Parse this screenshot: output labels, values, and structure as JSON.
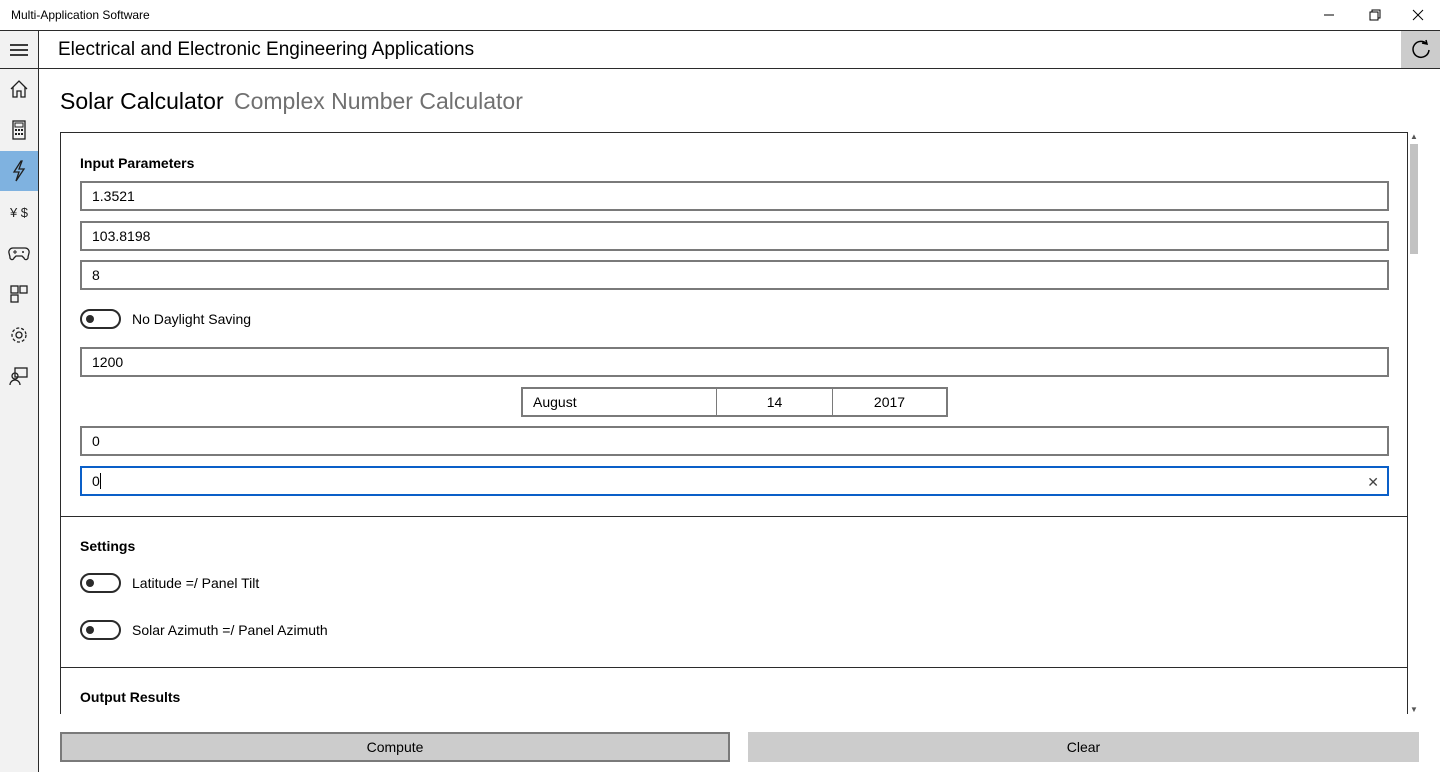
{
  "window": {
    "title": "Multi-Application Software",
    "controls": {
      "minimize_icon": "minimize-icon",
      "maximize_icon": "restore-icon",
      "close_icon": "close-icon"
    }
  },
  "header": {
    "title": "Electrical and Electronic Engineering Applications",
    "menu_icon": "hamburger-icon",
    "refresh_icon": "refresh-icon"
  },
  "sidebar": {
    "active_color": "#7fb2e0",
    "items": [
      {
        "icon": "home-icon",
        "label": ""
      },
      {
        "icon": "calculator-icon",
        "label": ""
      },
      {
        "icon": "lightning-icon",
        "label": "",
        "active": true
      },
      {
        "icon": "currency-icon",
        "label": "¥ $"
      },
      {
        "icon": "gamepad-icon",
        "label": ""
      },
      {
        "icon": "layout-icon",
        "label": ""
      },
      {
        "icon": "gear-icon",
        "label": ""
      },
      {
        "icon": "feedback-icon",
        "label": ""
      }
    ]
  },
  "tabs": [
    {
      "label": "Solar Calculator",
      "selected": true
    },
    {
      "label": "Complex Number Calculator",
      "selected": false
    }
  ],
  "input_parameters": {
    "title": "Input Parameters",
    "latitude": "1.3521",
    "longitude": "103.8198",
    "timezone": "8",
    "daylight_toggle_label": "No Daylight Saving",
    "time": "1200",
    "date": {
      "month": "August",
      "day": "14",
      "year": "2017"
    },
    "field_a": "0",
    "field_b": "0"
  },
  "settings": {
    "title": "Settings",
    "toggle1_label": "Latitude =/ Panel Tilt",
    "toggle2_label": "Solar Azimuth =/ Panel Azimuth"
  },
  "output": {
    "title": "Output Results"
  },
  "buttons": {
    "compute": "Compute",
    "clear": "Clear"
  },
  "colors": {
    "focus_border": "#0a5fc8",
    "button_bg": "#cccccc"
  }
}
